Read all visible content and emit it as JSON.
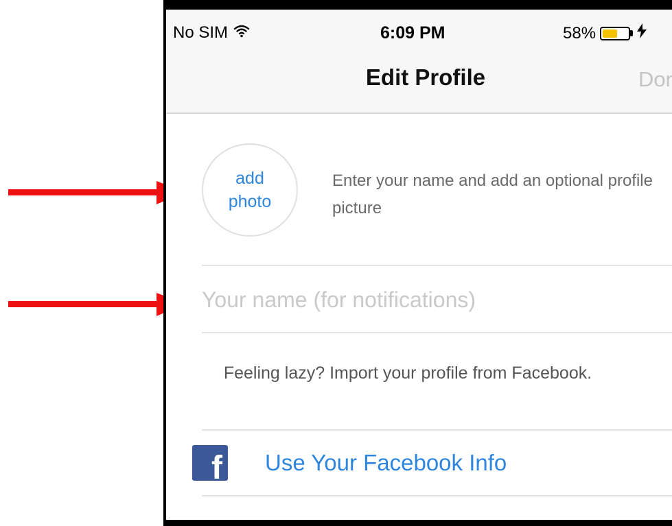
{
  "status_bar": {
    "carrier": "No SIM",
    "time": "6:09 PM",
    "battery_percent": "58%",
    "battery_level": 0.58,
    "icons": [
      "wifi-icon",
      "battery-icon",
      "charging-icon"
    ]
  },
  "nav": {
    "title": "Edit Profile",
    "done_label": "Done"
  },
  "profile": {
    "add_photo_label": "add\nphoto",
    "intro_text": "Enter your name and add an optional profile picture",
    "name_placeholder": "Your name (for notifications)",
    "name_value": ""
  },
  "facebook": {
    "lazy_text": "Feeling lazy? Import your profile from Facebook.",
    "button_label": "Use Your Facebook Info",
    "logo_letter": "f"
  },
  "annotations": {
    "arrow_color": "#ee1111",
    "arrow_icons": [
      "red-arrow-icon",
      "red-arrow-icon"
    ]
  },
  "colors": {
    "link_blue": "#2e86de",
    "facebook_blue": "#3b5998",
    "done_disabled": "#c4c4c4"
  }
}
